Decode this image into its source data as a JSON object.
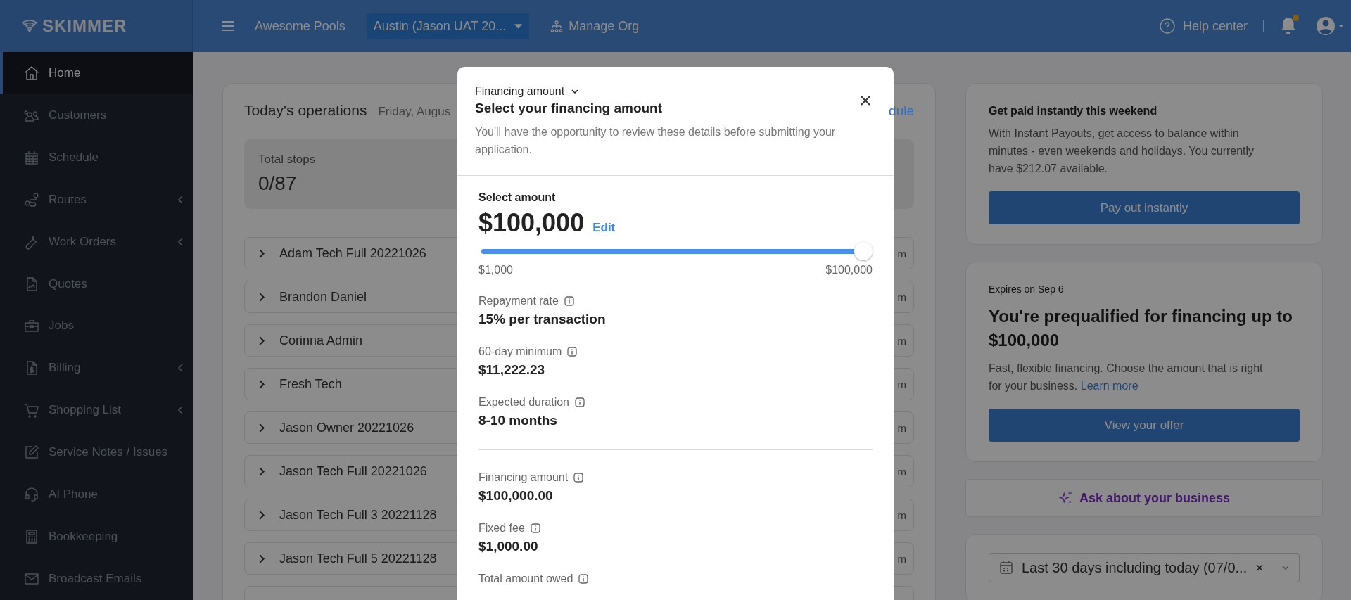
{
  "topbar": {
    "logo": "SKIMMER",
    "org": "Awesome Pools",
    "location": "Austin (Jason UAT 20...",
    "manage": "Manage Org",
    "help": "Help center",
    "notifications_unread": true
  },
  "sidebar": {
    "items": [
      {
        "label": "Home",
        "selected": true,
        "expandable": false
      },
      {
        "label": "Customers",
        "selected": false,
        "expandable": false
      },
      {
        "label": "Schedule",
        "selected": false,
        "expandable": false
      },
      {
        "label": "Routes",
        "selected": false,
        "expandable": true
      },
      {
        "label": "Work Orders",
        "selected": false,
        "expandable": true
      },
      {
        "label": "Quotes",
        "selected": false,
        "expandable": false
      },
      {
        "label": "Jobs",
        "selected": false,
        "expandable": false
      },
      {
        "label": "Billing",
        "selected": false,
        "expandable": true
      },
      {
        "label": "Shopping List",
        "selected": false,
        "expandable": true
      },
      {
        "label": "Service Notes / Issues",
        "selected": false,
        "expandable": false
      },
      {
        "label": "AI Phone",
        "selected": false,
        "expandable": false
      },
      {
        "label": "Bookkeeping",
        "selected": false,
        "expandable": false
      },
      {
        "label": "Broadcast Emails",
        "selected": false,
        "expandable": false
      }
    ]
  },
  "operations": {
    "title": "Today's operations",
    "date": "Friday, Augus",
    "link": "dule",
    "stats": [
      {
        "label": "Total stops",
        "value": "0/87"
      }
    ],
    "rows": [
      {
        "name": "Adam Tech Full 20221026",
        "column_2": "m"
      },
      {
        "name": "Brandon Daniel",
        "column_2": "m"
      },
      {
        "name": "Corinna Admin",
        "column_2": "m"
      },
      {
        "name": "Fresh Tech",
        "column_2": "m"
      },
      {
        "name": "Jason Owner 20221026",
        "column_2": "m"
      },
      {
        "name": "Jason Tech Full 20221026",
        "column_2": "m"
      },
      {
        "name": "Jason Tech Full 3 20221128",
        "column_2": "m"
      },
      {
        "name": "Jason Tech Full 5 20221128",
        "column_2": "m"
      }
    ]
  },
  "payout": {
    "title": "Get paid instantly this weekend",
    "text": "With Instant Payouts, get access to balance within minutes - even weekends and holidays. You currently have $212.07 available.",
    "button": "Pay out instantly"
  },
  "financing_offer": {
    "expires": "Expires on Sep 6",
    "heading": "You're prequalified for financing up to $100,000",
    "text": "Fast, flexible financing. Choose the amount that is right for your business.",
    "link": "Learn more",
    "button": "View your offer"
  },
  "ask": {
    "label": "Ask about your business"
  },
  "filter": {
    "value": "Last 30 days including today (07/0...",
    "clear": "×"
  },
  "modal": {
    "breadcrumb": "Financing amount",
    "title": "Select your financing amount",
    "subtitle": "You'll have the opportunity to review these details before submitting your application.",
    "select_label": "Select amount",
    "amount": "$100,000",
    "edit": "Edit",
    "slider": {
      "level": 1,
      "min": "$1,000",
      "max": "$100,000"
    },
    "sections": [
      {
        "items": [
          {
            "label": "Repayment rate",
            "value": "15% per transaction"
          },
          {
            "label": "60-day minimum",
            "value": "$11,222.23"
          },
          {
            "label": "Expected duration",
            "value": "8-10 months"
          }
        ]
      },
      {
        "items": [
          {
            "label": "Financing amount",
            "value": "$100,000.00"
          },
          {
            "label": "Fixed fee",
            "value": "$1,000.00"
          },
          {
            "label": "Total amount owed"
          }
        ]
      }
    ]
  }
}
